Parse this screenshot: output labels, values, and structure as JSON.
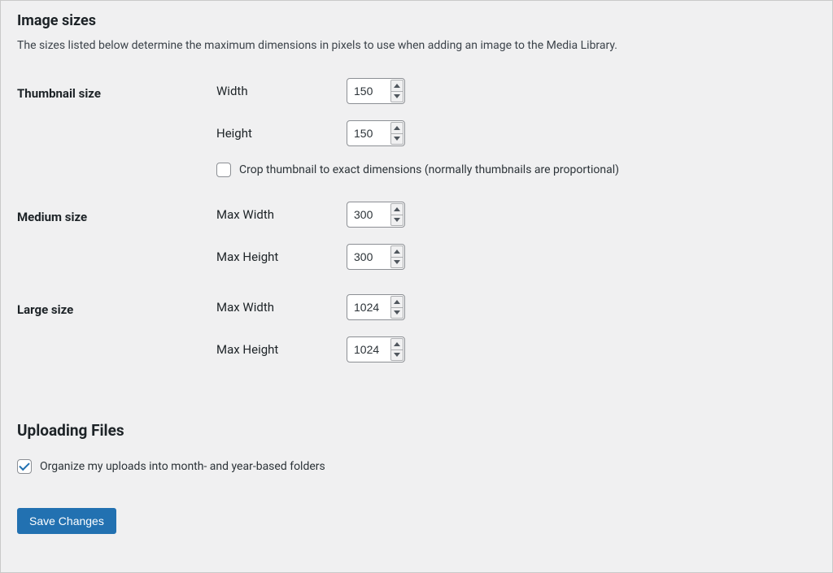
{
  "sections": {
    "image_sizes": {
      "title": "Image sizes",
      "description": "The sizes listed below determine the maximum dimensions in pixels to use when adding an image to the Media Library."
    },
    "uploading_files": {
      "title": "Uploading Files"
    }
  },
  "thumbnail": {
    "heading": "Thumbnail size",
    "width_label": "Width",
    "width_value": "150",
    "height_label": "Height",
    "height_value": "150",
    "crop_label": "Crop thumbnail to exact dimensions (normally thumbnails are proportional)",
    "crop_checked": false
  },
  "medium": {
    "heading": "Medium size",
    "width_label": "Max Width",
    "width_value": "300",
    "height_label": "Max Height",
    "height_value": "300"
  },
  "large": {
    "heading": "Large size",
    "width_label": "Max Width",
    "width_value": "1024",
    "height_label": "Max Height",
    "height_value": "1024"
  },
  "uploads": {
    "organize_label": "Organize my uploads into month- and year-based folders",
    "organize_checked": true
  },
  "actions": {
    "save_label": "Save Changes"
  }
}
